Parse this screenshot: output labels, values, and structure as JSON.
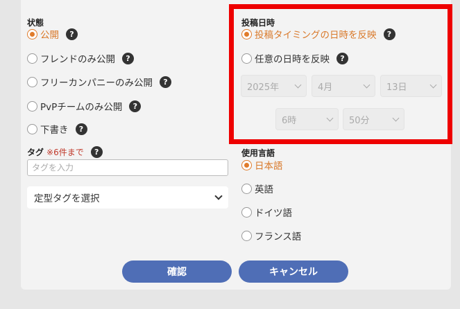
{
  "status": {
    "label": "状態",
    "help_glyph": "?",
    "options": [
      {
        "label": "公開",
        "selected": true
      },
      {
        "label": "フレンドのみ公開",
        "selected": false
      },
      {
        "label": "フリーカンパニーのみ公開",
        "selected": false
      },
      {
        "label": "PvPチームのみ公開",
        "selected": false
      },
      {
        "label": "下書き",
        "selected": false
      }
    ]
  },
  "tag": {
    "label": "タグ",
    "note": "※6件まで",
    "placeholder": "タグを入力",
    "select_label": "定型タグを選択"
  },
  "post_datetime": {
    "label": "投稿日時",
    "options": [
      {
        "label": "投稿タイミングの日時を反映",
        "selected": true
      },
      {
        "label": "任意の日時を反映",
        "selected": false
      }
    ],
    "year": "2025年",
    "month": "4月",
    "day": "13日",
    "hour": "6時",
    "minute": "50分"
  },
  "language": {
    "label": "使用言語",
    "options": [
      {
        "label": "日本語",
        "selected": true
      },
      {
        "label": "英語",
        "selected": false
      },
      {
        "label": "ドイツ語",
        "selected": false
      },
      {
        "label": "フランス語",
        "selected": false
      }
    ]
  },
  "buttons": {
    "confirm": "確認",
    "cancel": "キャンセル"
  },
  "colors": {
    "accent": "#e07b2a",
    "button": "#4f6eb6",
    "highlight": "#ee0000"
  }
}
